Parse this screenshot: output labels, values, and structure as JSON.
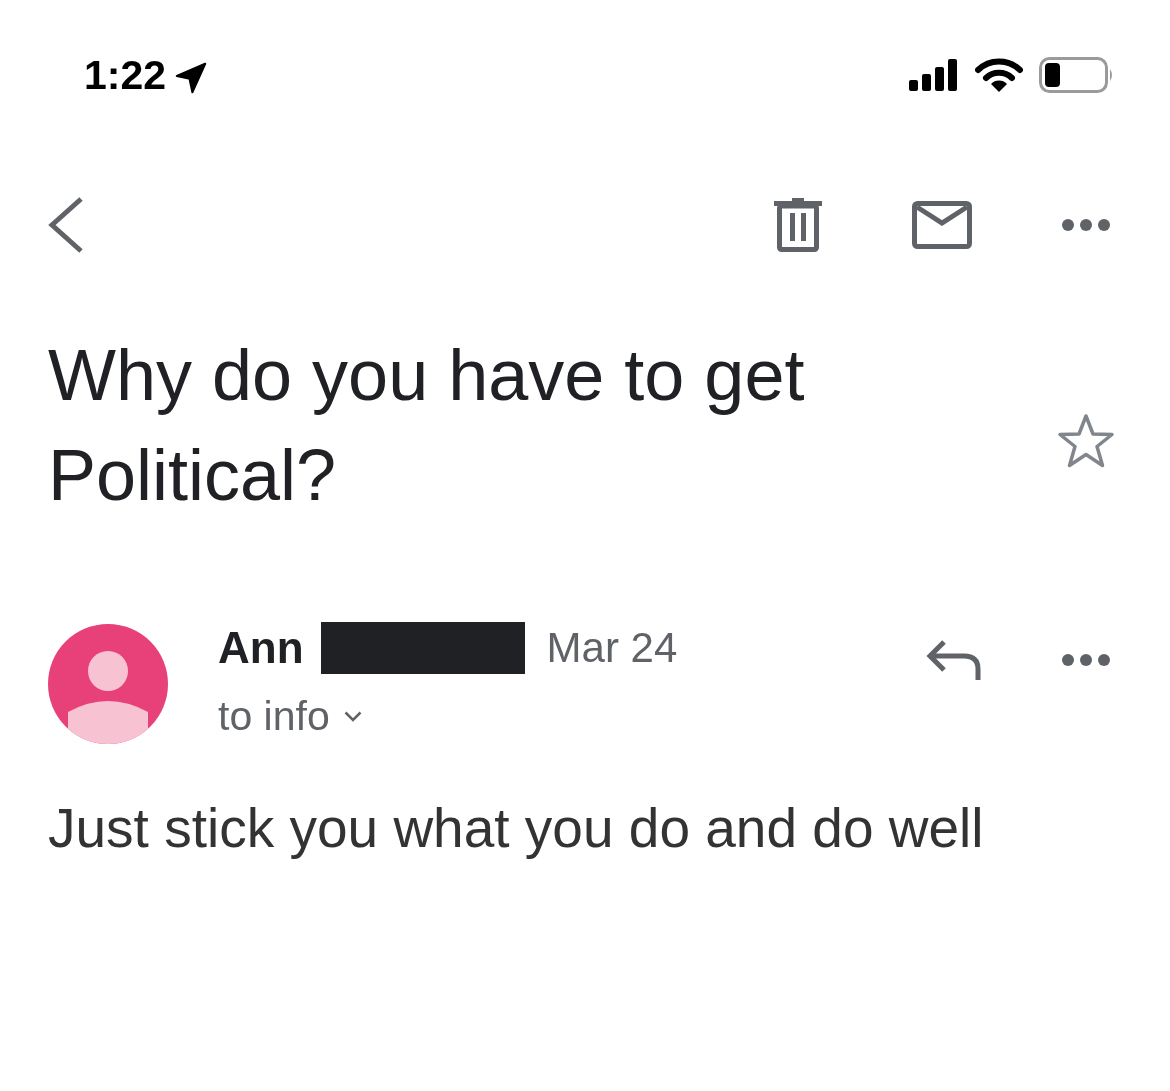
{
  "status_bar": {
    "time": "1:22"
  },
  "subject": {
    "text": "Why do you have to get Political?",
    "starred": false
  },
  "message": {
    "sender": "Ann",
    "date": "Mar 24",
    "recipient": "to info",
    "body": "Just stick you what you do and do well"
  }
}
